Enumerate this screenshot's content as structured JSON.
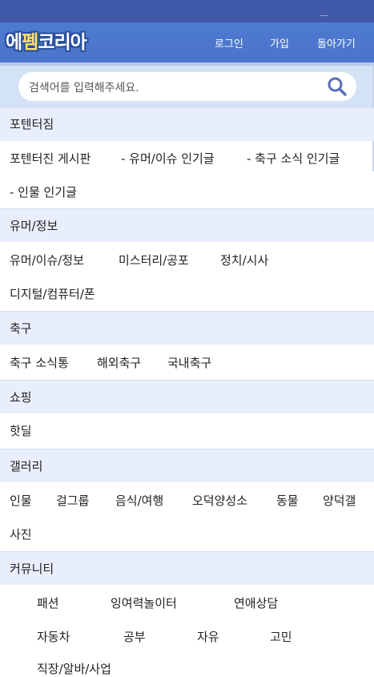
{
  "header": {
    "logo_prefix": "에",
    "logo_highlight": "펨",
    "logo_suffix": "코리아",
    "nav": [
      "로그인",
      "가입",
      "돌아가기"
    ]
  },
  "search": {
    "placeholder": "검색어를 입력해주세요."
  },
  "sections": [
    {
      "title": "포텐터짐",
      "links": [
        "포텐터진 게시판",
        "- 유머/이슈 인기글",
        "- 축구 소식 인기글",
        "- 인물 인기글"
      ]
    },
    {
      "title": "유머/정보",
      "links": [
        "유머/이슈/정보",
        "미스터리/공포",
        "정치/시사",
        "디지털/컴퓨터/폰"
      ]
    },
    {
      "title": "축구",
      "links": [
        "축구 소식통",
        "해외축구",
        "국내축구"
      ]
    },
    {
      "title": "쇼핑",
      "links": [
        "핫딜"
      ]
    },
    {
      "title": "갤러리",
      "links": [
        "인물",
        "걸그룹",
        "음식/여행",
        "오덕양성소",
        "동물",
        "양덕갤",
        "사진"
      ]
    },
    {
      "title": "커뮤니티",
      "links": [
        "패션",
        "잉여력놀이터",
        "연애상담",
        "자동차",
        "공부",
        "자유",
        "고민",
        "직장/알바/사업"
      ]
    }
  ],
  "colors": {
    "header": "#4a74c9",
    "statusbar": "#3f58a8",
    "search_bg": "#d4e2f6",
    "section_bg": "#e8eefb",
    "search_icon": "#5a6fb8"
  }
}
